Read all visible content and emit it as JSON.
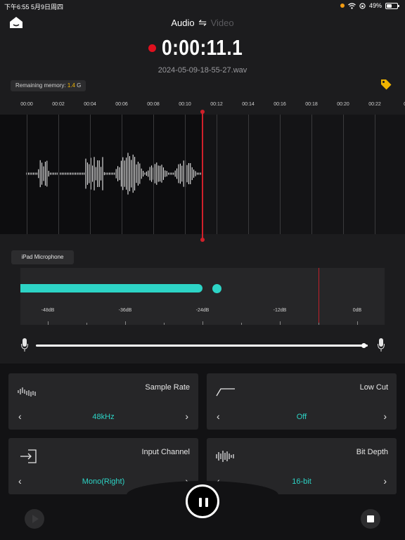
{
  "status_bar": {
    "time_date": "下午6:55   5月9日周四",
    "battery": "49%",
    "battery_level": 0.49
  },
  "header": {
    "mode_audio": "Audio",
    "mode_swap": "⇋",
    "mode_video": "Video",
    "timer": "0:00:11.1",
    "filename": "2024-05-09-18-55-27.wav"
  },
  "memory": {
    "label": "Remaining memory: ",
    "value": "1.4",
    "unit": " G"
  },
  "timeline": {
    "ticks": [
      "00:00",
      "00:02",
      "00:04",
      "00:06",
      "00:08",
      "00:10",
      "00:12",
      "00:14",
      "00:16",
      "00:18",
      "00:20",
      "00:22",
      "00"
    ]
  },
  "input": {
    "device": "iPad Microphone"
  },
  "level_meter": {
    "scale": [
      "-48dB",
      "-36dB",
      "-24dB",
      "-12dB",
      "0dB"
    ],
    "level_db": -24,
    "peak_db": -22,
    "clip_db": -6
  },
  "gain": {
    "level": 0.99
  },
  "settings": {
    "sample_rate": {
      "title": "Sample Rate",
      "value": "48kHz"
    },
    "low_cut": {
      "title": "Low Cut",
      "value": "Off"
    },
    "input_channel": {
      "title": "Input Channel",
      "value": "Mono(Right)"
    },
    "bit_depth": {
      "title": "Bit Depth",
      "value": "16-bit"
    }
  },
  "colors": {
    "accent": "#2dd4c6",
    "record": "#e0101e",
    "memory_value": "#f0b400",
    "tag": "#f0b400"
  },
  "icons": {
    "home": "home-icon",
    "tag": "tag-icon",
    "mic": "microphone-icon",
    "sample_rate": "waveform-icon",
    "low_cut": "low-cut-filter-icon",
    "input_channel": "input-arrow-icon",
    "bit_depth": "audio-bars-icon",
    "pause": "pause-icon",
    "play": "play-icon",
    "stop": "stop-icon"
  }
}
